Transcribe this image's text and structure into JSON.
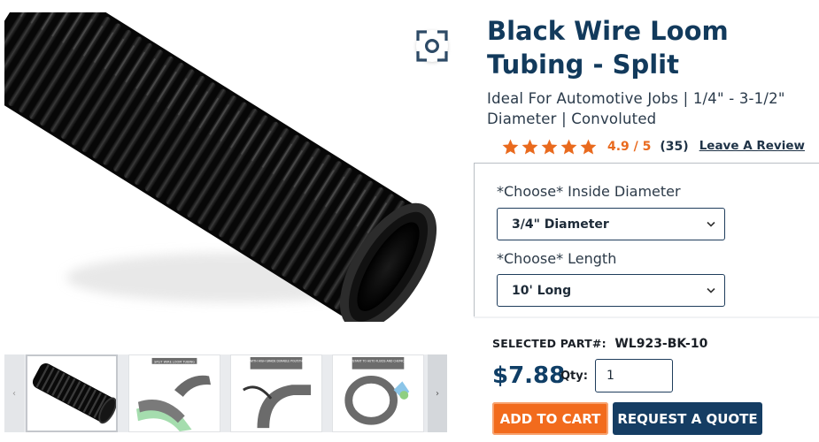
{
  "gallery": {
    "zoom_icon": "zoom-expand-icon",
    "prev_arrow": "‹",
    "next_arrow": "›",
    "thumbnails": [
      {
        "caption": ""
      },
      {
        "caption": "SPLIT WIRE LOOM TUBING"
      },
      {
        "caption": "MADE WITH HIGH GRADE DURABLE POLYETHYLENE"
      },
      {
        "caption": "RESISTANT TO AUTO FLUIDS AND CHEMICALS"
      }
    ]
  },
  "product": {
    "title": "Black Wire Loom Tubing - Split",
    "subtitle": "Ideal For Automotive Jobs | 1/4\" - 3-1/2\" Diameter | Convoluted",
    "rating": {
      "stars": 5,
      "value_text": "4.9 / 5",
      "count_text": "(35)",
      "review_link": "Leave A Review"
    }
  },
  "options": {
    "diameter": {
      "label": "*Choose* Inside Diameter",
      "selected": "3/4\" Diameter"
    },
    "length": {
      "label": "*Choose* Length",
      "selected": "10' Long"
    }
  },
  "purchase": {
    "selected_part_label": "SELECTED PART#:",
    "selected_part_value": "WL923-BK-10",
    "price": "$7.88",
    "qty_label": "Qty:",
    "qty_value": "1",
    "add_to_cart": "ADD TO CART",
    "request_quote": "REQUEST A QUOTE"
  },
  "colors": {
    "title": "#123a5c",
    "star": "#e96a1e",
    "cart_button": "#f26b1d",
    "quote_button": "#153d63",
    "price": "#0f3e66"
  }
}
